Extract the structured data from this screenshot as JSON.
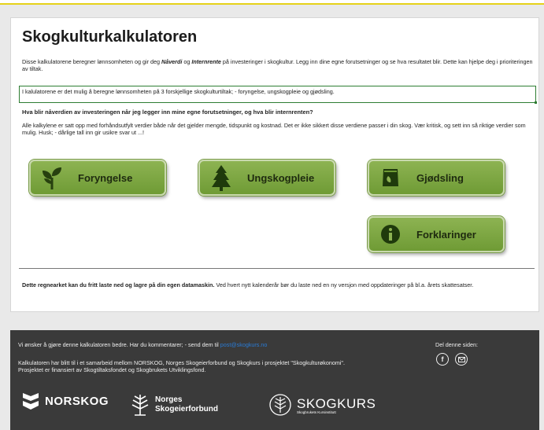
{
  "page": {
    "title": "Skogkulturkalkulatoren",
    "intro_pre": "Disse kalkulatorene beregner lønnsomheten og gir deg ",
    "intro_b1": "Nåverdi",
    "intro_mid": " og ",
    "intro_b2": "Internrente",
    "intro_post": " på investeringer i skogkultur. Legg inn dine egne forutsetninger og se hva resultatet blir. Dette kan hjelpe deg i prioriteringen av tiltak.",
    "info_text": "I kalulatorene er det mulig å beregne lønnsomheten på 3 forskjellige skogkulturtiltak; - foryngelse, ungskogpleie og gjødsling.",
    "question": "Hva blir nåverdien av investeringen når jeg legger inn mine egne forutsetninger, og hva blir internrenten?",
    "paragraph": "Alle kalkylene er satt opp med forhåndsutfylt verdier både når det gjelder mengde, tidspunkt og kostnad. Det er ikke sikkert disse verdiene passer i din skog. Vær kritisk, og sett inn så riktige verdier som mulig. Husk; - dårlige tall inn gir usikre svar ut ...!",
    "bottom_bold": "Dette regnearket kan du fritt laste ned og lagre på din egen datamaskin.",
    "bottom_rest": " Ved hvert nytt kalenderår bør du laste ned en ny versjon med oppdateringer på bl.a. årets skattesatser."
  },
  "buttons": {
    "foryngelse": "Foryngelse",
    "ungskogpleie": "Ungskogpleie",
    "gjodsling": "Gjødsling",
    "forklaringer": "Forklaringer"
  },
  "icons": {
    "foryngelse": "seedling-icon",
    "ungskogpleie": "tree-icon",
    "gjodsling": "fertilizer-bag-icon",
    "forklaringer": "info-icon"
  },
  "footer": {
    "feedback_pre": "Vi ønsker å gjøre denne kalkulatoren bedre. Har du kommentarer; - send dem til ",
    "email": "post@skogkurs.no",
    "collab": "Kalkulatoren har blitt til i et samarbeid mellom NORSKOG, Norges Skogeierforbund og Skogkurs i prosjektet \"Skogkulturøkonomi\". Prosjektet er finansiert av Skogtiltaksfondet og Skogbrukets Utviklingsfond.",
    "share_label": "Del denne siden:",
    "facebook_glyph": "f",
    "logo_norskog": "NORSKOG",
    "logo_norges_line1": "Norges",
    "logo_norges_line2": "Skogeierforbund",
    "logo_skogkurs": "SKOGKURS",
    "logo_skogkurs_sub": "Skogbrukets Kursinstitutt"
  },
  "colors": {
    "accent_yellow": "#e6d21a",
    "button_green": "#7ea844",
    "footer_bg": "#3a3a3a",
    "info_border": "#2e7d32"
  }
}
